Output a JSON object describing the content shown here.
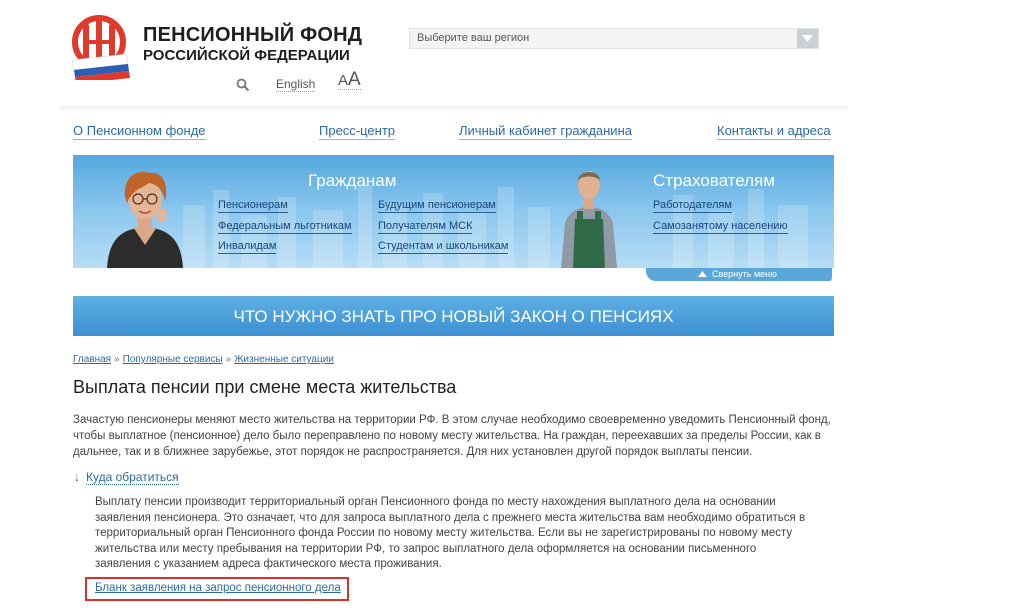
{
  "header": {
    "org_name_line1": "ПЕНСИОННЫЙ ФОНД",
    "org_name_line2": "РОССИЙСКОЙ ФЕДЕРАЦИИ",
    "english_link": "English",
    "font_size_toggle_small": "A",
    "font_size_toggle_big": "A",
    "region_select": {
      "selected": "Выберите ваш регион"
    },
    "icons": {
      "search": "search-icon",
      "region_arrow": "chevron-down-icon",
      "logo": "pfr-logo"
    }
  },
  "nav": {
    "items": [
      "О Пенсионном фонде",
      "Пресс-центр",
      "Личный кабинет гражданина",
      "Контакты и адреса"
    ]
  },
  "hero": {
    "citizens_heading": "Гражданам",
    "insurers_heading": "Страхователям",
    "links": [
      "Пенсионерам",
      "Федеральным льготникам",
      "Инвалидам",
      "Будущим пенсионерам",
      "Получателям МСК",
      "Студентам и школьникам",
      "Работодателям",
      "Самозанятому населению"
    ],
    "collapse_label": "Свернуть меню"
  },
  "banner": {
    "text": "ЧТО НУЖНО ЗНАТЬ ПРО НОВЫЙ ЗАКОН О ПЕНСИЯХ"
  },
  "breadcrumb": {
    "items": [
      "Главная",
      "Популярные сервисы",
      "Жизненные ситуации"
    ],
    "separator": "»"
  },
  "content": {
    "title": "Выплата пенсии при смене места жительства",
    "intro": "Зачастую пенсионеры меняют место жительства на территории РФ. В этом случае необходимо своевременно уведомить Пенсионный фонд, чтобы выплатное (пенсионное) дело было переправлено по новому месту жительства. На граждан, переехавших за пределы России, как в дальнее, так и в ближнее зарубежье, этот порядок не распространяется. Для них установлен другой порядок выплаты пенсии.",
    "where_toggle_arrow": "↓",
    "where_toggle": "Куда обратиться",
    "where_text": "Выплату пенсии производит территориальный орган Пенсионного фонда по месту нахождения  выплатного дела на основании заявления пенсионера. Это означает, что для запроса выплатного дела с прежнего места жительства вам необходимо обратиться в территориальный орган Пенсионного фонда России по новому месту жительства. Если вы не зарегистрированы по новому месту жительства или месту пребывания на территории РФ, то запрос выплатного дела оформляется на основании письменного заявления с указанием адреса фактического места проживания.",
    "form_link": "Бланк заявления на запрос пенсионного дела"
  },
  "colors": {
    "link": "#2b6aa8",
    "banner": "#3c8fd2",
    "highlight_border": "#d9302c",
    "logo_red": "#e03a2c"
  }
}
